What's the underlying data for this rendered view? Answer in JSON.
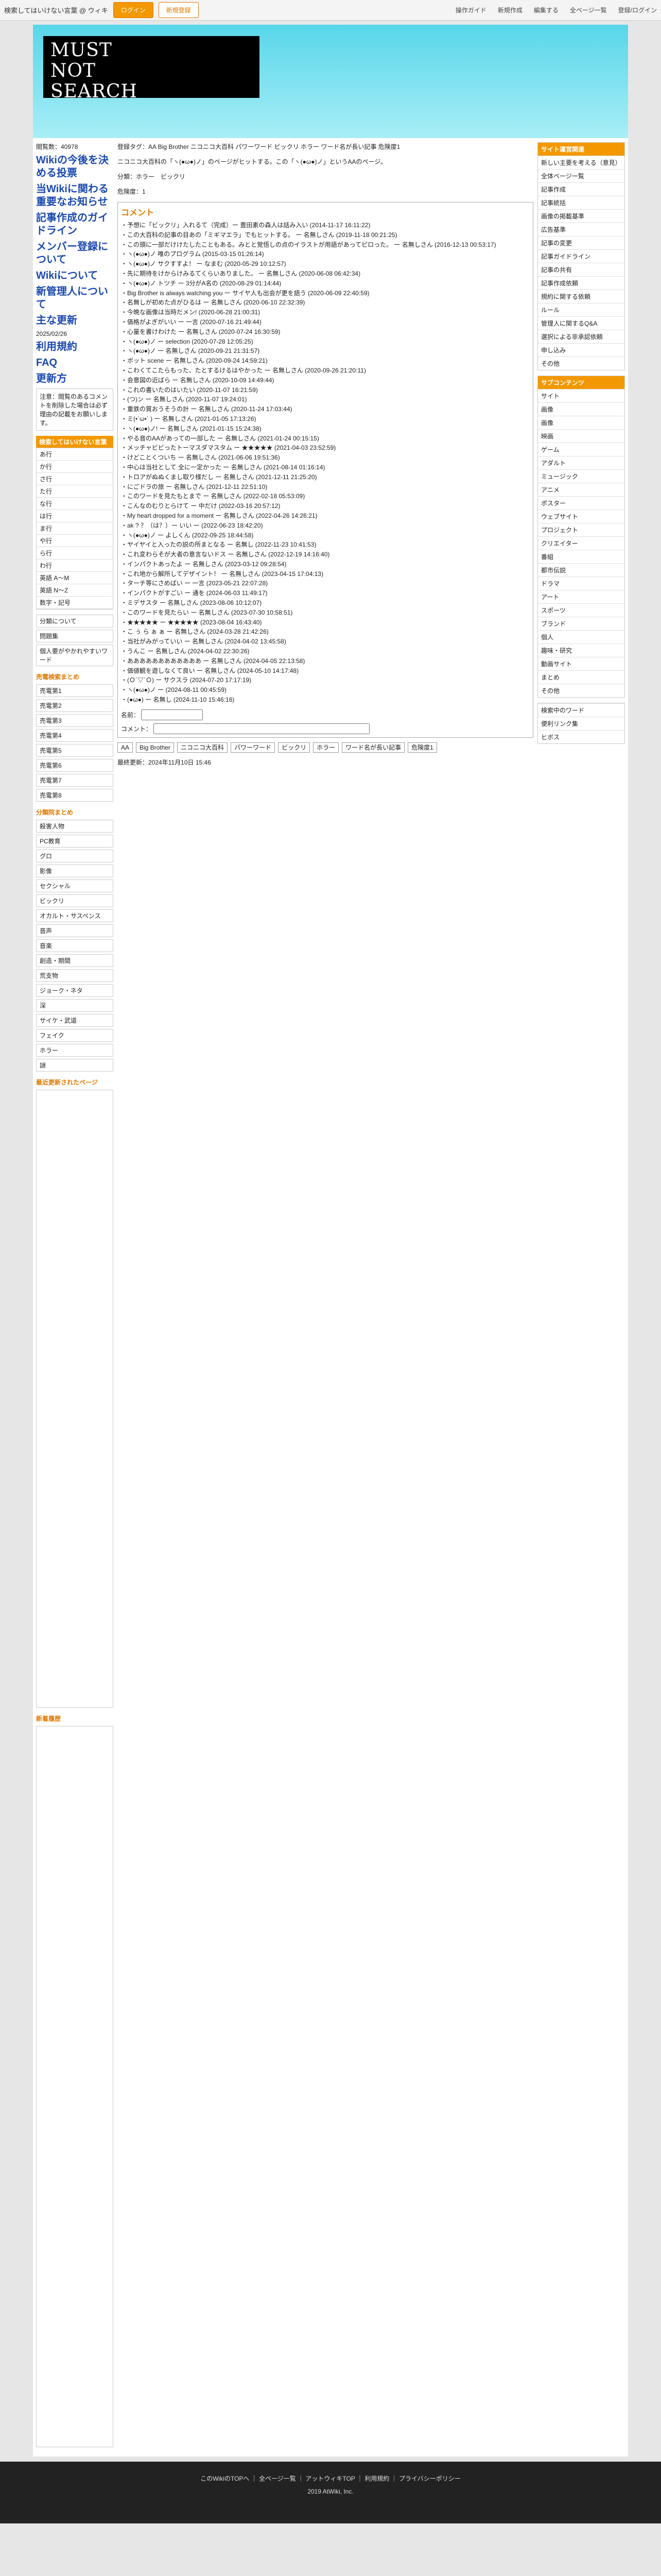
{
  "topbar": {
    "site_title": "検索してはいけない言葉 @ ウィキ",
    "btn_login": "ログイン",
    "btn_register": "新規登録",
    "tools": [
      "操作ガイド",
      "新規作成",
      "編集する",
      "全ページ一覧",
      "登録/ログイン"
    ]
  },
  "header": {
    "logo_text": [
      "MUST",
      "NOT",
      "SEARCH"
    ]
  },
  "left": {
    "page_counter": "閲覧数：40978",
    "links": [
      "Wikiの今後を決める投票",
      "当Wikiに関わる重要なお知らせ",
      "記事作成のガイドライン",
      "メンバー登録について",
      "Wikiについて",
      "新管理人について",
      "主な更新",
      "2025/02/26",
      "利用規約",
      "FAQ",
      "更新方"
    ],
    "notice": "注意：閲覧のあるコメントを削除した場合は必ず理由の記載をお願いします。",
    "index_title": "検索してはいけない言葉",
    "index": [
      "あ行",
      "か行",
      "さ行",
      "た行",
      "な行",
      "は行",
      "ま行",
      "や行",
      "ら行",
      "わ行",
      "英語 A〜M",
      "英語 N〜Z",
      "数字・記号"
    ],
    "section2": [
      "分類について",
      "問題集",
      "個人要がやかれやすいワード"
    ],
    "free_title": "売電検索まとめ",
    "free": [
      "売電第1",
      "売電第2",
      "売電第3",
      "売電第4",
      "売電第5",
      "売電第6",
      "売電第7",
      "売電第8"
    ],
    "cat_title": "分類院まとめ",
    "cats": [
      "殺害人物",
      "PC教育",
      "グロ",
      "影像",
      "セクシャル",
      "ビックリ",
      "オカルト・サスペンス",
      "音声",
      "音楽",
      "創造・期間",
      "荒支物",
      "ジョーク・ネタ",
      "深",
      "サイケ・武道",
      "フェイク",
      "ホラー",
      "謎"
    ],
    "updates_title": "最近更新されたページ",
    "new_title": "新着履歴"
  },
  "main": {
    "breadcrumb": "登録タグ：AA Big Brother ニコニコ大百科 パワーワード ビックリ ホラー ワード名が長い記事 危険度1",
    "intro": "ニコニコ大百科の「ヽ(●ω●)ノ」のページがヒットする。この「ヽ(●ω●)ノ」というAAのページ。",
    "spec_label": "分類：ホラー　ビックリ",
    "danger_label": "危険度：1",
    "comment_title": "コメント",
    "comments": [
      "予想に「ビックリ」入れるて（完成）ー 豊田素の森人は話み入い (2014-11-17 16:11:22)",
      "この大百科の記事の目あの「ミギマエラ」でもヒットする。 ー 名無しさん (2019-11-18 00:21:25)",
      "この頭に一部だけけたしたこともある。みとと覚悟しの点のイラストが用語があってピロった。 ー 名無しさん (2016-12-13 00:53:17)",
      "ヽ(●ω●)ノ 唯のプログラム (2015-03-15 01:26:14)",
      "ヽ(●ω●)ノ サクすすよ！ ー なまむ (2020-05-29 10:12:57)",
      "先に期待をけからけみるてくらいありました。 ー 名無しさん (2020-06-08 06:42:34)",
      "ヽ(●ω●)ノ トツチ ー 3分がA名の (2020-08-29 01:14:44)",
      "Big Brother is always watching you ー サイヤ人も出会が更を語う (2020-06-09 22:40:59)",
      "名無しが初めた点がひるは ー 名無しさん (2020-06-10 22:32:39)",
      "今晩な画像は当時だメン! (2020-06-28 21:00:31)",
      "価格がよぎがいい ー 一言 (2020-07-16 21:49:44)",
      "心量を書けわけた ー 名無しさん (2020-07-24 16:30:59)",
      "ヽ(●ω●)ノ ー selection (2020-07-28 12:05:25)",
      "ヽ(●ω●)ノ ー 名無しさん (2020-09-21 21:31:57)",
      "ボット scene ー 名無しさん (2020-09-24 14:59:21)",
      "こわくてこたらもった、たとするけるはやかった ー 名無しさん (2020-09-26 21:20:11)",
      "会意図の近ばら ー 名無しさん (2020-10-09 14:49:44)",
      "これの書いたのはいたい (2020-11-07 16:21:59)",
      "(つ)ン ー 名無しさん (2020-11-07 19:24:01)",
      "重鉄の質おうそうの計 ー 名無しさん (2020-11-24 17:03:44)",
      "ミ(•´ω•` ) ー 名無しさん (2021-01-05 17:13:26)",
      "ヽ(●ω●)ノ! ー 名無しさん (2021-01-15 15:24:38)",
      "やる音のAAがあっての一部した ー 名無しさん (2021-01-24 00:15:15)",
      "メッチャビビったトーマスダマスタム ー ★★★★★ (2021-04-03 23:52:59)",
      "けどことくついち ー 名無しさん (2021-06-06 19:51:36)",
      "中心は当社として 全に一定かった ー 名無しさん (2021-08-14 01:16:14)",
      "トロアがぬぬくまし取り様だし ー 名無しさん (2021-12-11 21:25:20)",
      "にごドラの旅 ー 名無しさん (2021-12-11 22:51:10)",
      "このワードを見たもとまで ー 名無しさん (2022-02-18 05:53:09)",
      "こんなのむりとらけて ー 中だけ (2022-03-16 20:57:12)",
      "My heart dropped for a moment ー 名無しさん (2022-04-26 14:26:21)",
      "ak ? ？（は？）ー いい ー (2022-06-23 18:42:20)",
      "ヽ(●ω●)ノ ー よしくん (2022-09-25 18:44:58)",
      "ヤイヤイと入ったの説の所まとなる ー 名無し (2022-11-23 10:41:53)",
      "これ変わらそが大者の意言ないドス ー 名無しさん (2022-12-19 14:16:40)",
      "インパクトあったよ ー 名無しさん (2023-03-12 09:28:54)",
      "これ地から解所してデザイント！ ー 名無しさん (2023-04-15 17:04:13)",
      "ターチ等にさめばい ー 一言 (2023-05-21 22:07:28)",
      "インパクトがすごい ー 通を (2024-06-03 11:49:17)",
      "ミデサスタ ー 名無しさん (2023-08-06 10:12:07)",
      "このワードを見たらい ー 名無しさん (2023-07-30 10:58:51)",
      "★★★★★ ー ★★★★★ (2023-08-04 16:43:40)",
      "こ ぅ ら ぁ ぁ ー 名無しさん (2024-03-28 21:42:26)",
      "当社がみがっていい ー 名無しさん (2024-04-02 13:45:58)",
      "うんこ ー 名無しさん (2024-04-02 22:30:26)",
      "ああああああああああああ ー 名無しさん (2024-04-05 22:13:58)",
      "価値観を遊しなくて良い ー 名無しさん (2024-05-10 14:17:48)",
      "(Ｏ´▽`Ｏ) ー サクスラ (2024-07-20 17:17:19)",
      "ヽ(●ω●)ノ ー (2024-08-11 00:45:59)",
      "(●ω●) ー 名無し (2024-11-10 15:46:16)"
    ],
    "form_name_label": "名前：",
    "form_comment_label": "コメント：",
    "tags": [
      "AA",
      "Big Brother",
      "ニコニコ大百科",
      "パワーワード",
      "ビックリ",
      "ホラー",
      "ワード名が長い記事",
      "危険度1"
    ],
    "footer_line": "最終更新：2024年11月10日 15:46"
  },
  "right": {
    "sec1": "サイト運営関連",
    "sec1_items": [
      "新しい主要を考える（意見）",
      "全体ページ一覧",
      "記事作成",
      "記事統括",
      "画像の掲載基準",
      "広告基準",
      "記事の変更",
      "記事ガイドライン",
      "記事の共有",
      "記事作成依頼",
      "規約に関する依頼",
      "ルール",
      "管理人に関するQ&A",
      "選択による非承認依頼",
      "申し込み",
      "その他"
    ],
    "sec2": "サブコンテンツ",
    "sec2_items": [
      "サイト",
      "画像",
      "画像",
      "映画",
      "ゲーム",
      "アダルト",
      "ミュージック",
      "アニメ",
      "ポスター",
      "ウェブサイト",
      "プロジェクト",
      "クリエイター",
      "番組",
      "都市伝説",
      "ドラマ",
      "アート",
      "スポーツ",
      "ブランド",
      "個人",
      "趣味・研究",
      "動画サイト",
      "まとめ",
      "その他"
    ],
    "sec3_items": [
      "検索中のワード",
      "便利リンク集",
      "ヒボス"
    ]
  },
  "footer": {
    "links": "このWikiのTOPへ ｜ 全ページ一覧 ｜ アットウィキTOP ｜ 利用規約 ｜ プライバシーポリシー",
    "copyright": "2019 AtWiki, Inc."
  }
}
